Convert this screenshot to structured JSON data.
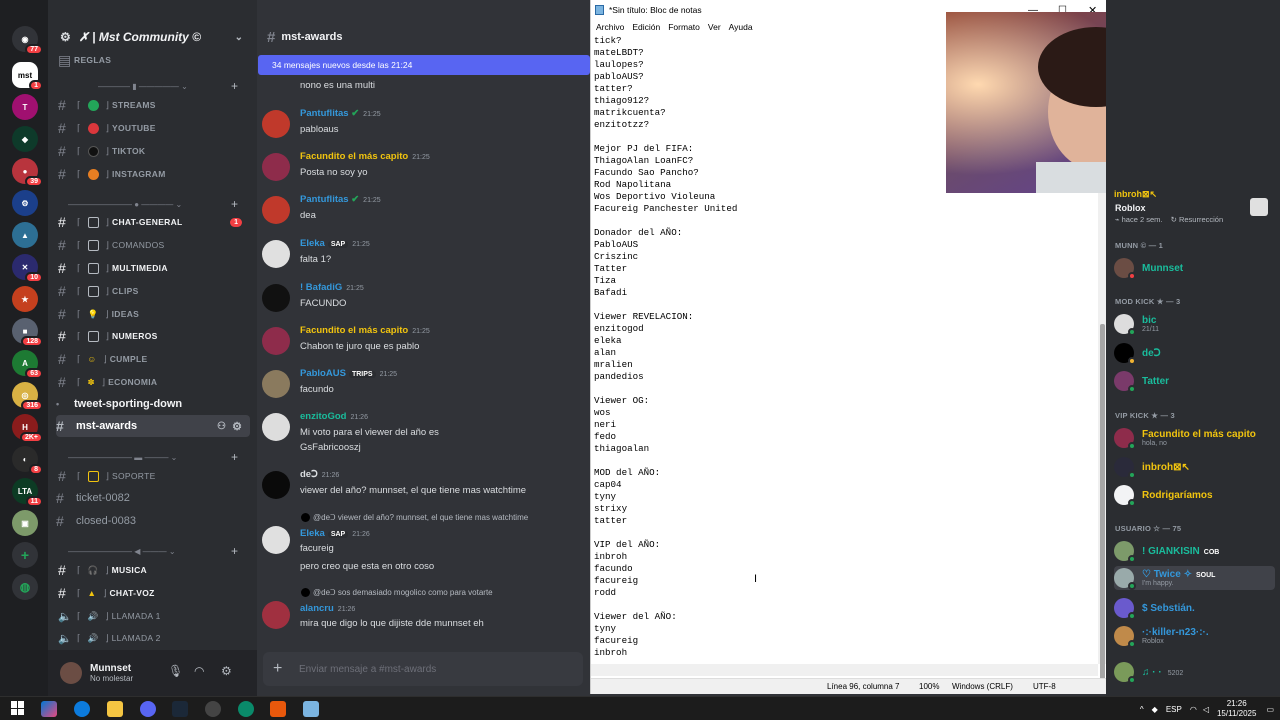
{
  "server": {
    "name": "✗ | Mst Community ©",
    "categories": [
      {
        "label": "REGLAS"
      }
    ],
    "channels": {
      "reglas": "REGLAS",
      "streams": "STREAMS",
      "youtube": "YOUTUBE",
      "tiktok": "TIKTOK",
      "instagram": "INSTAGRAM",
      "chat_general": "CHAT-GENERAL",
      "chat_general_badge": "1",
      "comandos": "COMANDOS",
      "multimedia": "MULTIMEDIA",
      "clips": "CLIPS",
      "ideas": "IDEAS",
      "numeros": "NUMEROS",
      "cumple": "CUMPLE",
      "economia": "ECONOMIA",
      "tweet": "tweet-sporting-down",
      "mst_awards": "mst-awards",
      "soporte": "SOPORTE",
      "ticket": "ticket-0082",
      "closed": "closed-0083",
      "musica": "MUSICA",
      "chat_voz": "CHAT-VOZ",
      "llamada1": "LLAMADA 1",
      "llamada2": "LLAMADA 2"
    }
  },
  "rail_badges": [
    "77",
    "1",
    "39",
    "10",
    "128",
    "63",
    "316",
    "2K+",
    "8",
    "11"
  ],
  "user": {
    "name": "Munnset",
    "status": "No molestar"
  },
  "chat": {
    "channel": "mst-awards",
    "new_messages": "34 mensajes nuevos desde las 21:24",
    "input_placeholder": "Enviar mensaje a #mst-awards",
    "messages": [
      {
        "text": "nono es una multi"
      },
      {
        "author": "Pantuflitas",
        "time": "21:25",
        "text": "pabloaus"
      },
      {
        "author": "Facundito el más capito",
        "time": "21:25",
        "text": "Posta no soy yo"
      },
      {
        "author": "Pantuflitas",
        "time": "21:25",
        "text": "dea"
      },
      {
        "author": "Eleka",
        "tag": "SAP",
        "time": "21:25",
        "text": "falta 1?"
      },
      {
        "author": "! BafadiG",
        "time": "21:25",
        "text": "FACUNDO"
      },
      {
        "author": "Facundito el más capito",
        "time": "21:25",
        "text": "Chabon te juro que es pablo"
      },
      {
        "author": "PabloAUS",
        "tag": "TRIPS",
        "time": "21:25",
        "text": "facundo"
      },
      {
        "author": "enzitoGod",
        "time": "21:26",
        "text": "Mi voto para el viewer del año es",
        "text2": "GsFabricooszj"
      },
      {
        "author": "deↃ",
        "time": "21:26",
        "text": "viewer del año? munnset, el que tiene mas watchtime"
      },
      {
        "reply": "@deↃ viewer del año? munnset, el que tiene mas watchtime",
        "author": "Eleka",
        "tag": "SAP",
        "time": "21:26",
        "text": "facureig",
        "text2": "pero creo que esta en otro coso"
      },
      {
        "reply": "@deↃ sos demasiado mogolico como para votarte",
        "author": "alancru",
        "time": "21:26",
        "text": "mira que digo lo que dijiste dde munnset eh"
      }
    ]
  },
  "notepad": {
    "title": "*Sin título: Bloc de notas",
    "menu": [
      "Archivo",
      "Edición",
      "Formato",
      "Ver",
      "Ayuda"
    ],
    "text": "tick?\nmateLBDT?\nlaulopes?\npabloAUS?\ntatter?\nthiago912?\nmatrikcuenta?\nenzitotzz?\n\nMejor PJ del FIFA:\nThiagoAlan LoanFC?\nFacundo Sao Pancho?\nRod Napolitana\nWos Deportivo Violeuna\nFacureig Panchester United\n\nDonador del AÑO:\nPabloAUS\nCriszinc\nTatter\nTiza\nBafadi\n\nViewer REVELACION:\nenzitogod\neleka\nalan\nmralien\npandedios\n\nViewer OG:\nwos\nneri\nfedo\nthiagoalan\n\nMOD del AÑO:\ncap04\ntyny\nstrixy\ntatter\n\nVIP del AÑO:\ninbroh\nfacundo\nfacureig\nrodd\n\nViewer del AÑO:\ntyny\nfacureig\ninbroh",
    "status": {
      "position": "Línea 96, columna 7",
      "zoom": "100%",
      "eol": "Windows (CRLF)",
      "encoding": "UTF-8"
    }
  },
  "members": {
    "activity": {
      "name": "inbroh⊠↖",
      "app": "Roblox",
      "meta": "hace 2 sem.",
      "replay": "Resurrección"
    },
    "groups": [
      {
        "header": "MUNN © — 1",
        "members": [
          {
            "name": "Munnset",
            "color": "#1abc9c"
          }
        ]
      },
      {
        "header": "MOD KICK ★ — 3",
        "members": [
          {
            "name": "bic",
            "sub": "21/11",
            "color": "#1abc9c"
          },
          {
            "name": "deↃ",
            "color": "#1abc9c"
          },
          {
            "name": "Tatter",
            "color": "#1abc9c"
          }
        ]
      },
      {
        "header": "VIP KICK ★ — 3",
        "members": [
          {
            "name": "Facundito el más capito",
            "sub": "hola, no",
            "color": "#f1c40f"
          },
          {
            "name": "inbroh⊠↖",
            "color": "#f1c40f"
          },
          {
            "name": "Rodrigaríamos",
            "color": "#f1c40f"
          }
        ]
      },
      {
        "header": "USUARIO ☆ — 75",
        "members": [
          {
            "name": "! GIANKISIN",
            "tag": "COB",
            "color": "#1abc9c"
          },
          {
            "name": "♡ Twice ✧",
            "tag": "SOUL",
            "sub": "I'm happy.",
            "color": "#3498db"
          },
          {
            "name": "$ Sebstián.",
            "color": "#3498db"
          },
          {
            "name": "·:·killer-n23·:·.",
            "sub": "Roblox",
            "color": "#3498db"
          },
          {
            "name": "♫ · ·",
            "sub": "5202",
            "color": "#1abc9c"
          }
        ]
      }
    ]
  },
  "taskbar": {
    "lang": "ESP",
    "time": "21:26",
    "date": "15/11/2025"
  }
}
